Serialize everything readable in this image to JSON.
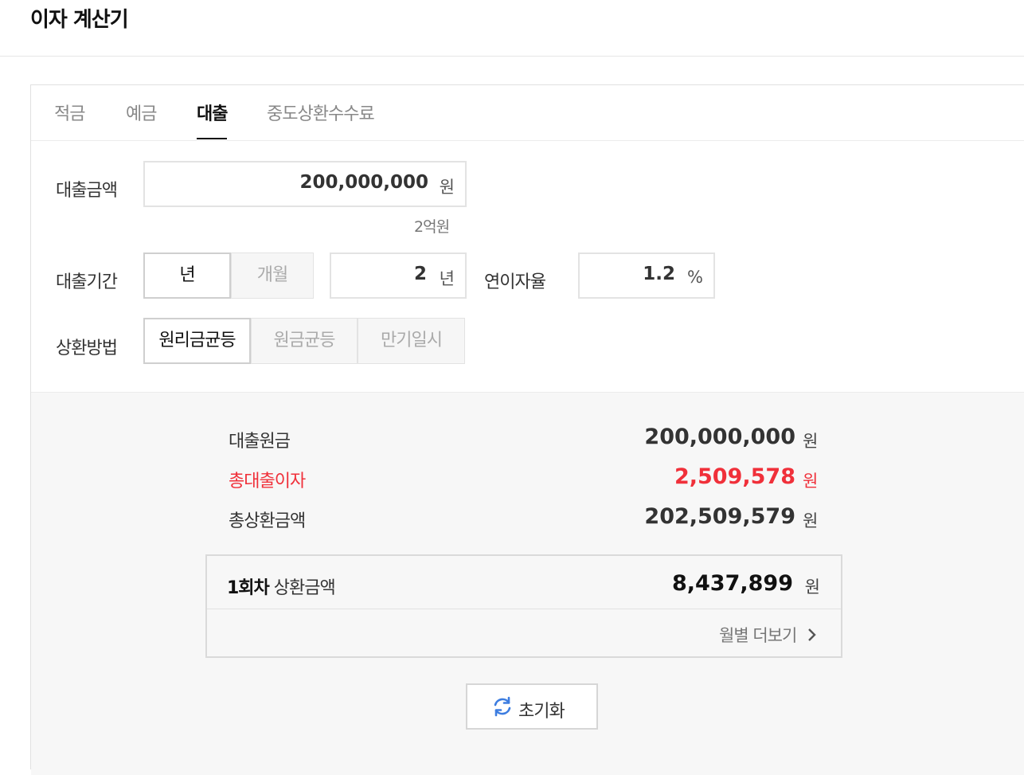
{
  "page": {
    "title": "이자 계산기"
  },
  "tabs": [
    "적금",
    "예금",
    "대출",
    "중도상환수수료"
  ],
  "form": {
    "loan_amount_label": "대출금액",
    "loan_amount_value": "200,000,000",
    "loan_amount_unit": "원",
    "loan_amount_hint": "2억원",
    "period_label": "대출기간",
    "period_unit_year": "년",
    "period_unit_month": "개월",
    "period_value": "2",
    "period_value_unit": "년",
    "rate_label": "연이자율",
    "rate_value": "1.2",
    "rate_unit": "%",
    "method_label": "상환방법",
    "methods": [
      "원리금균등",
      "원금균등",
      "만기일시"
    ]
  },
  "results": {
    "principal_label": "대출원금",
    "principal_value": "200,000,000",
    "interest_label": "총대출이자",
    "interest_value": "2,509,578",
    "total_label": "총상환금액",
    "total_value": "202,509,579",
    "currency": "원",
    "first_payment_label_bold": "1회차",
    "first_payment_label": "상환금액",
    "first_payment_value": "8,437,899",
    "monthly_more": "월별 더보기",
    "reset_label": "초기화"
  },
  "colors": {
    "accent_red": "#f0303a",
    "refresh_icon": "#3d7de0"
  }
}
